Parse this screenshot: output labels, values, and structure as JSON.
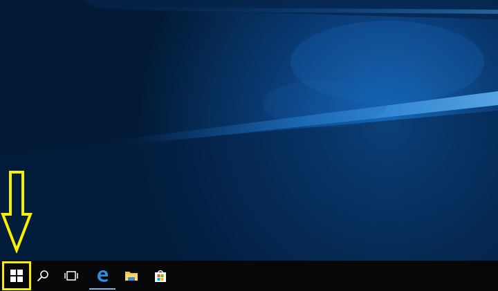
{
  "desktop": {
    "wallpaper": "windows-10-hero-light",
    "background_color": "#021a36",
    "light_color": "#1679d4"
  },
  "taskbar": {
    "background_color": "#050709",
    "items": [
      {
        "id": "start",
        "icon": "windows-logo-icon",
        "label": ""
      },
      {
        "id": "search",
        "icon": "search-icon",
        "label": ""
      },
      {
        "id": "task-view",
        "icon": "task-view-icon",
        "label": ""
      },
      {
        "id": "edge",
        "icon": "edge-icon",
        "label": "",
        "active": true
      },
      {
        "id": "file-explorer",
        "icon": "folder-icon",
        "label": ""
      },
      {
        "id": "store",
        "icon": "store-icon",
        "label": ""
      }
    ]
  },
  "annotation": {
    "arrow_direction": "down",
    "highlight_target": "start",
    "color": "#f7ee00"
  }
}
